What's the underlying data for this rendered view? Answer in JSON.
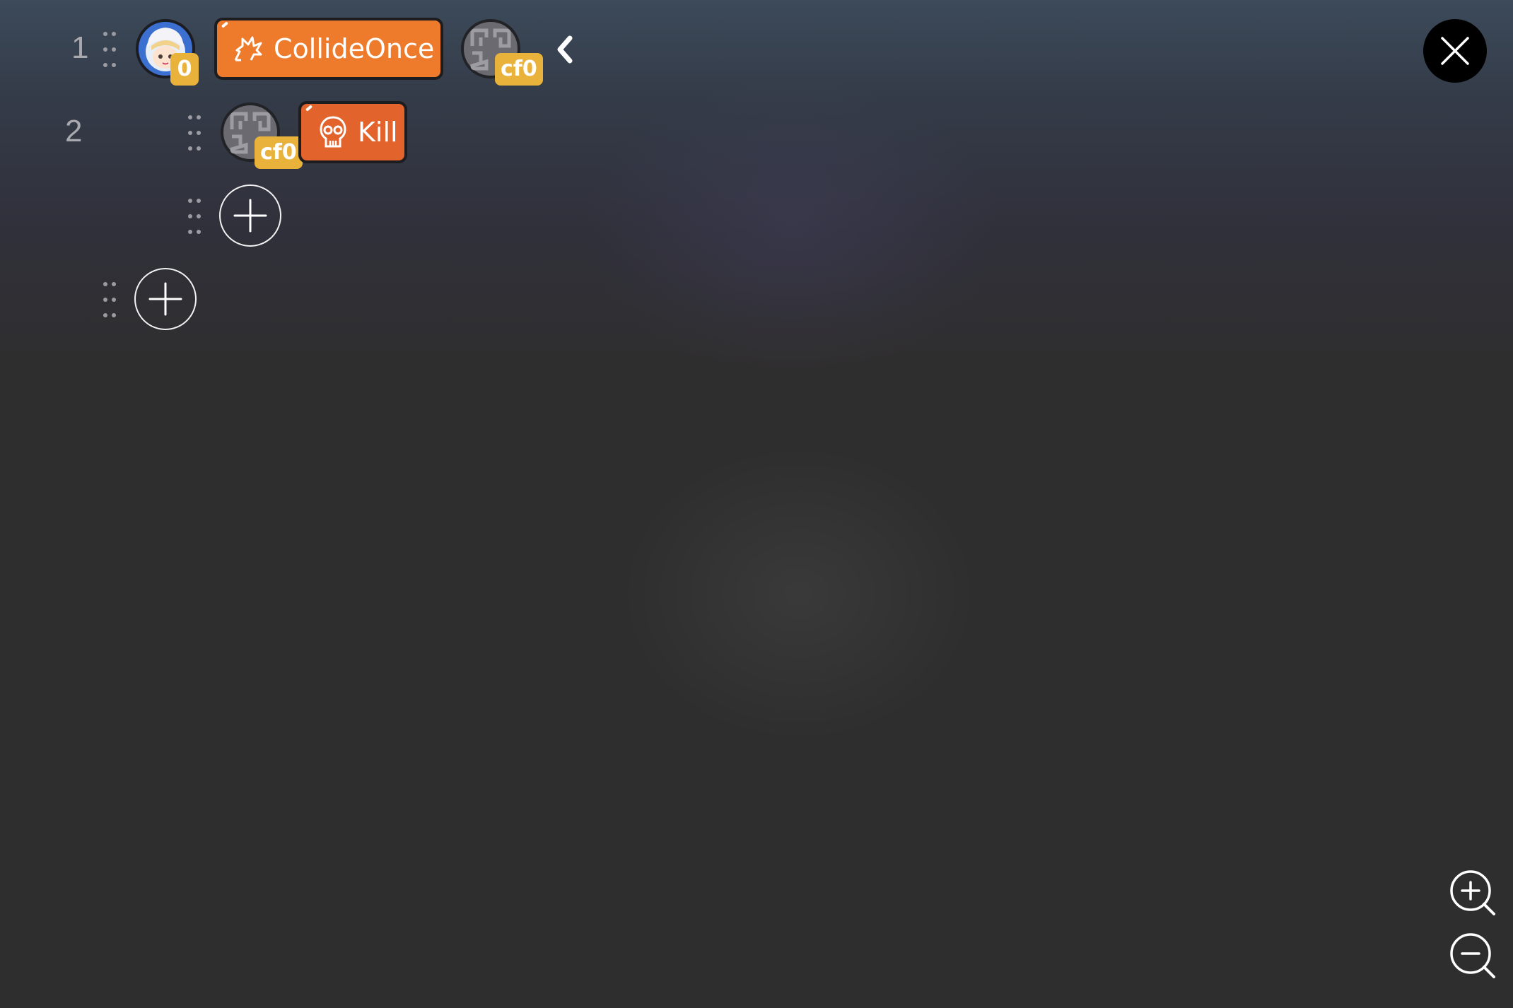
{
  "rows": [
    {
      "number": "1",
      "player_badge": "0",
      "action_label": "CollideOnce",
      "action_icon": "collision-burst-icon",
      "target_badge": "cf0"
    },
    {
      "number": "2",
      "target_badge": "cf0",
      "action_label": "Kill",
      "action_icon": "skull-icon"
    }
  ],
  "icons": {
    "collapse": "chevron-left-icon",
    "close": "close-icon",
    "zoom_in": "zoom-in-icon",
    "zoom_out": "zoom-out-icon",
    "add": "plus-icon",
    "drag": "drag-handle-icon"
  },
  "colors": {
    "action_chip_collide": "#ee7b2c",
    "action_chip_kill": "#e2632b",
    "badge": "#e9b33b"
  }
}
